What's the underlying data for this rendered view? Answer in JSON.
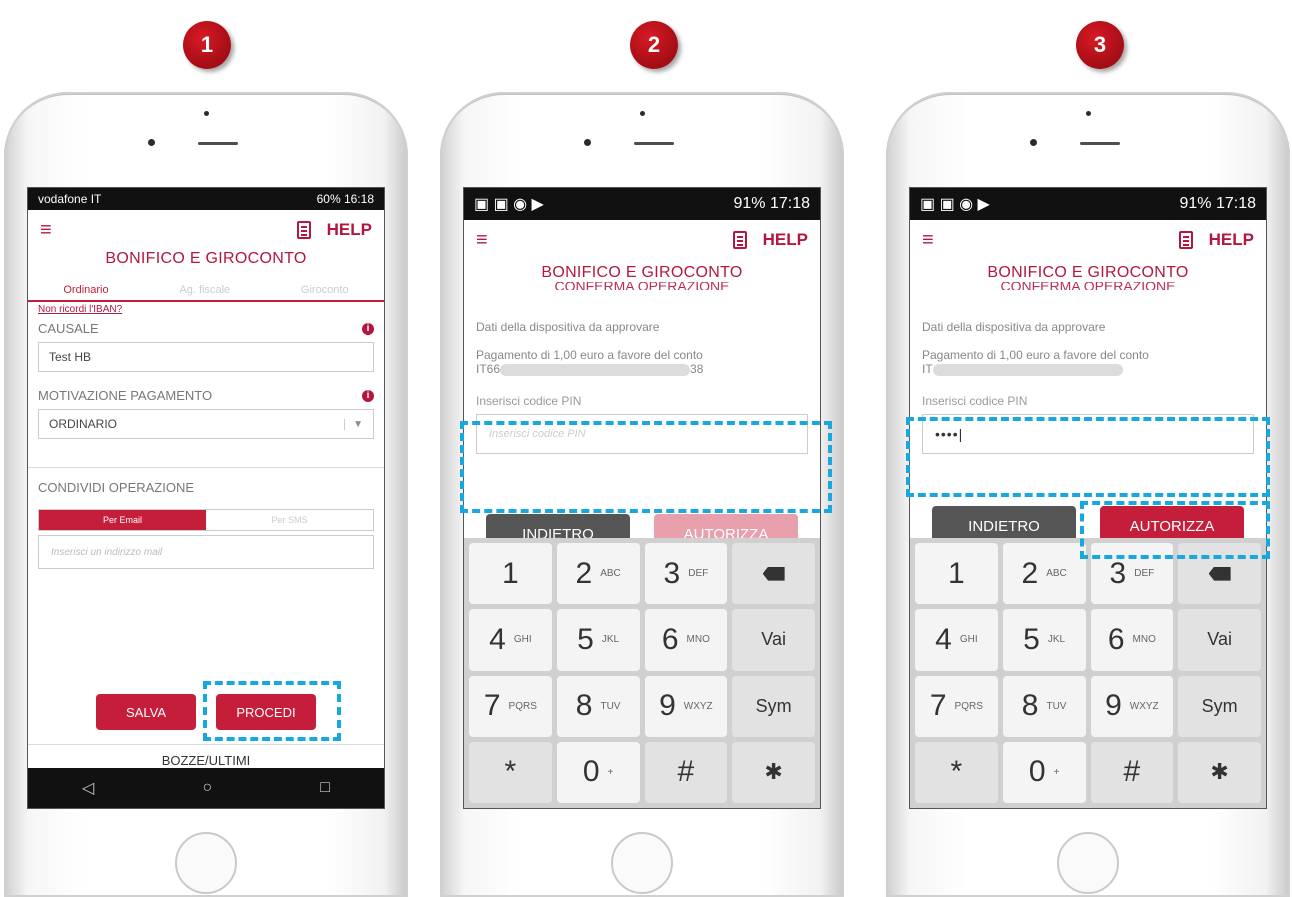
{
  "steps": [
    "1",
    "2",
    "3"
  ],
  "phone1": {
    "status_left": "vodafone IT",
    "status_right": "60%  16:18",
    "menu_icon": "hamburger-menu-icon",
    "help_label": "HELP",
    "title": "BONIFICO E GIROCONTO",
    "tabs": [
      "Ordinario",
      "Ag. fiscale",
      "Giroconto"
    ],
    "iban_link": "Non ricordi l'IBAN?",
    "causale_label": "CAUSALE",
    "causale_value": "Test HB",
    "motivazione_label": "MOTIVAZIONE PAGAMENTO",
    "motivazione_value": "ORDINARIO",
    "condividi_label": "CONDIVIDI OPERAZIONE",
    "toggle": [
      "Per Email",
      "Per SMS"
    ],
    "mail_placeholder": "Inserisci un indirizzo mail",
    "salva": "SALVA",
    "procedi": "PROCEDI",
    "bozze": "BOZZE/ULTIMI",
    "nav": [
      "◁",
      "○",
      "□"
    ]
  },
  "phone2": {
    "status_right": "91%  17:18",
    "help_label": "HELP",
    "title": "BONIFICO E GIROCONTO",
    "subtitle": "CONFERMA OPERAZIONE",
    "dati": "Dati della dispositiva da approvare",
    "pagamento": "Pagamento di 1,00 euro a favore del conto",
    "iban_start": "IT66",
    "iban_end": "38",
    "pin_label": "Inserisci codice PIN",
    "pin_placeholder": "Inserisci codice PIN",
    "indietro": "INDIETRO",
    "autorizza": "AUTORIZZA"
  },
  "phone3": {
    "status_right": "91%  17:18",
    "help_label": "HELP",
    "title": "BONIFICO E GIROCONTO",
    "subtitle": "CONFERMA OPERAZIONE",
    "dati": "Dati della dispositiva da approvare",
    "pagamento": "Pagamento di 1,00 euro a favore del conto",
    "iban_start": "IT",
    "pin_label": "Inserisci codice PIN",
    "pin_value": "••••|",
    "indietro": "INDIETRO",
    "autorizza": "AUTORIZZA"
  },
  "keypad": {
    "keys": [
      {
        "main": "1",
        "sub": ""
      },
      {
        "main": "2",
        "sub": "ABC"
      },
      {
        "main": "3",
        "sub": "DEF"
      },
      {
        "main": "",
        "sub": "backspace-icon"
      },
      {
        "main": "4",
        "sub": "GHI"
      },
      {
        "main": "5",
        "sub": "JKL"
      },
      {
        "main": "6",
        "sub": "MNO"
      },
      {
        "main": "Vai",
        "sub": ""
      },
      {
        "main": "7",
        "sub": "PQRS"
      },
      {
        "main": "8",
        "sub": "TUV"
      },
      {
        "main": "9",
        "sub": "WXYZ"
      },
      {
        "main": "Sym",
        "sub": ""
      },
      {
        "main": "*",
        "sub": ""
      },
      {
        "main": "0",
        "sub": "+"
      },
      {
        "main": "#",
        "sub": ""
      },
      {
        "main": "",
        "sub": "gear-icon"
      }
    ]
  },
  "colors": {
    "brand": "#c41e3a",
    "highlight": "#19a7e0",
    "step_badge": "#c0101a"
  }
}
